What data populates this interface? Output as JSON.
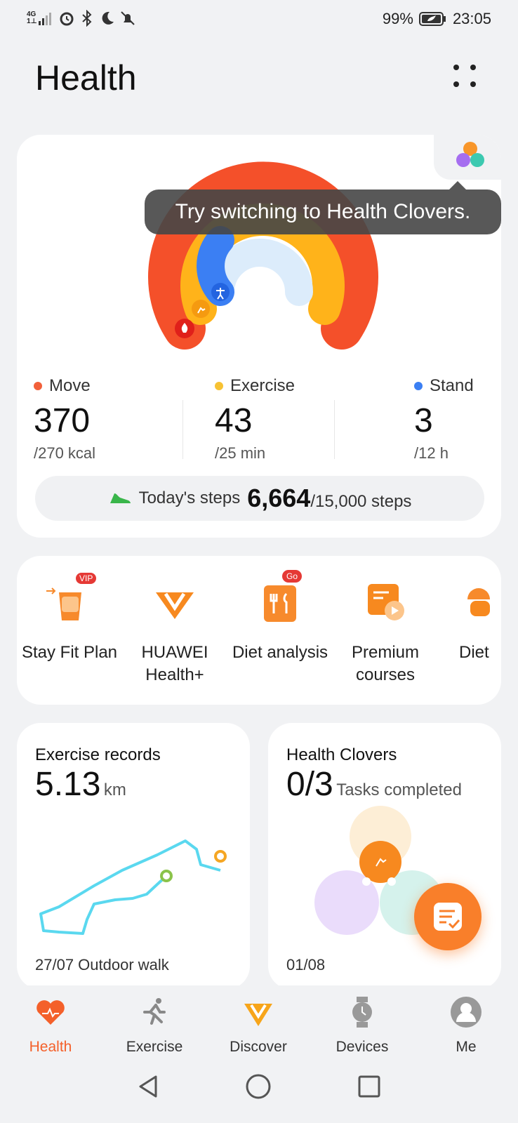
{
  "status": {
    "network": "4G",
    "signal_sub": "1⊥",
    "battery": "99%",
    "time": "23:05"
  },
  "header": {
    "title": "Health"
  },
  "tooltip": {
    "text": "Try switching to Health Clovers."
  },
  "rings": {
    "move_progress": 1.0,
    "exercise_progress": 1.0,
    "stand_progress": 0.25,
    "colors": {
      "move": "#f4502a",
      "exercise": "#ffb31a",
      "stand": "#3b7ff3"
    }
  },
  "metrics": {
    "move": {
      "label": "Move",
      "value": "370",
      "goal": "/270 kcal",
      "color": "#f2603a"
    },
    "exercise": {
      "label": "Exercise",
      "value": "43",
      "goal": "/25 min",
      "color": "#f7c233"
    },
    "stand": {
      "label": "Stand",
      "value": "3",
      "goal": "/12 h",
      "color": "#3b7ff3"
    }
  },
  "steps": {
    "label": "Today's steps",
    "value": "6,664",
    "goal": "/15,000 steps"
  },
  "services": [
    {
      "label": "Stay Fit Plan",
      "badge": "VIP"
    },
    {
      "label": "HUAWEI Health+"
    },
    {
      "label": "Diet analysis",
      "badge": "Go"
    },
    {
      "label": "Premium courses"
    },
    {
      "label": "Diet"
    }
  ],
  "exercise_card": {
    "title": "Exercise records",
    "value": "5.13",
    "unit": "km",
    "footer": "27/07 Outdoor walk"
  },
  "clovers_card": {
    "title": "Health Clovers",
    "value": "0/3",
    "unit": "Tasks completed",
    "footer": "01/08"
  },
  "nav": {
    "health": "Health",
    "exercise": "Exercise",
    "discover": "Discover",
    "devices": "Devices",
    "me": "Me",
    "active_color": "#f4602a"
  }
}
